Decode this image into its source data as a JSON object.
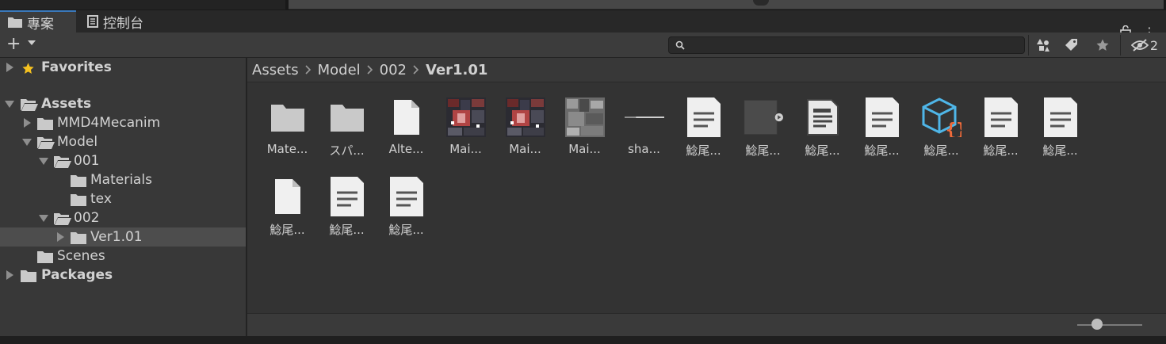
{
  "tabs": {
    "project_label": "專案",
    "console_label": "控制台"
  },
  "toolbar": {
    "add_label": "+",
    "search_placeholder": "",
    "hidden_count": "2"
  },
  "tree": {
    "favorites": "Favorites",
    "assets": "Assets",
    "mmd4mecanim": "MMD4Mecanim",
    "model": "Model",
    "f001": "001",
    "materials": "Materials",
    "tex": "tex",
    "f002": "002",
    "ver101": "Ver1.01",
    "scenes": "Scenes",
    "packages": "Packages"
  },
  "breadcrumb": [
    "Assets",
    "Model",
    "002",
    "Ver1.01"
  ],
  "assets": [
    {
      "name": "Mate...",
      "icon": "folder-icon"
    },
    {
      "name": "スパ...",
      "icon": "folder-icon"
    },
    {
      "name": "Alte...",
      "icon": "blank-file-icon"
    },
    {
      "name": "Mai...",
      "icon": "texture-color-icon"
    },
    {
      "name": "Mai...",
      "icon": "texture-color-icon"
    },
    {
      "name": "Mai...",
      "icon": "texture-gray-icon"
    },
    {
      "name": "sha...",
      "icon": "shader-line-icon"
    },
    {
      "name": "鯰尾...",
      "icon": "text-file-icon"
    },
    {
      "name": "鯰尾...",
      "icon": "model-prefab-icon"
    },
    {
      "name": "鯰尾...",
      "icon": "script-doc-icon"
    },
    {
      "name": "鯰尾...",
      "icon": "text-file-icon"
    },
    {
      "name": "鯰尾...",
      "icon": "json-icon"
    },
    {
      "name": "鯰尾...",
      "icon": "text-file-icon"
    },
    {
      "name": "鯰尾...",
      "icon": "text-file-icon"
    },
    {
      "name": "鯰尾...",
      "icon": "blank-file-icon"
    },
    {
      "name": "鯰尾...",
      "icon": "text-file-icon"
    },
    {
      "name": "鯰尾...",
      "icon": "text-file-icon"
    }
  ],
  "colors": {
    "accent": "#3a79bb",
    "favorite_star": "#f5c120",
    "json_brackets": "#f26b3a",
    "json_cube": "#4fb6e8"
  },
  "zoom_fraction": 0.3
}
